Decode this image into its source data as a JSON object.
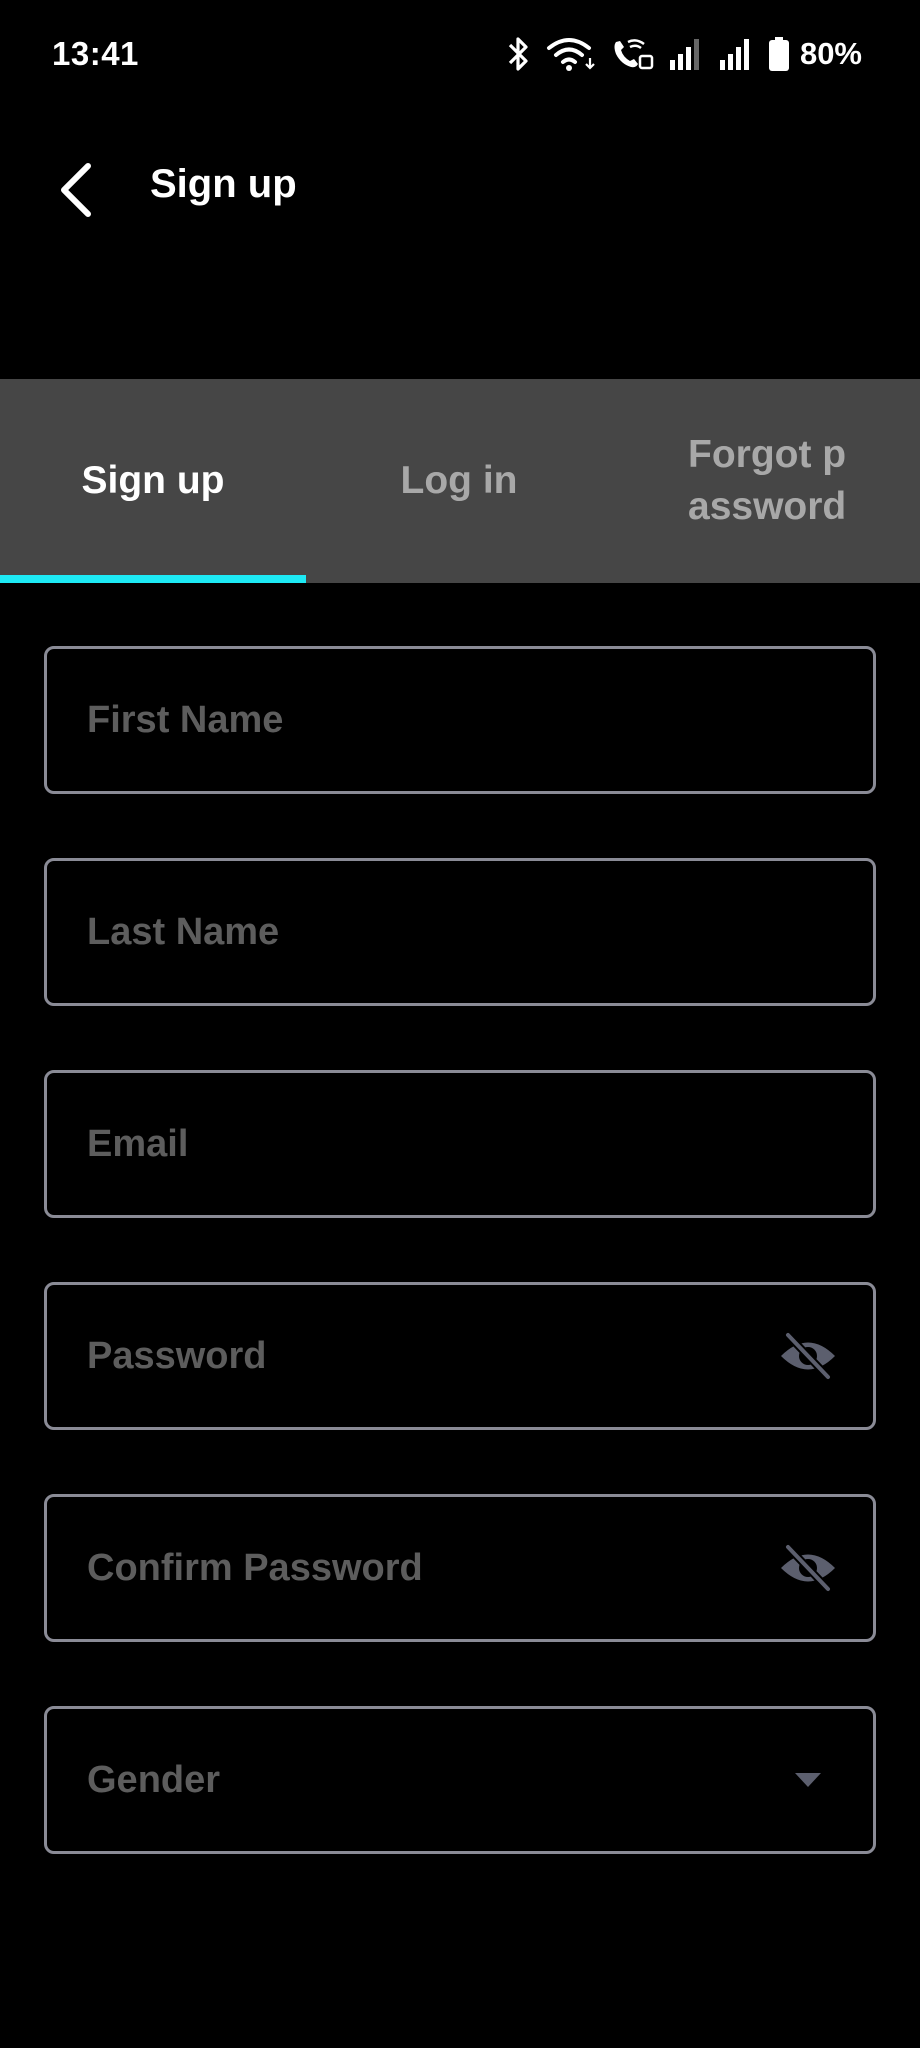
{
  "status_bar": {
    "time": "13:41",
    "battery": "80%",
    "icons": [
      "bluetooth-icon",
      "wifi-icon",
      "wifi-calling-icon",
      "signal-icon",
      "signal-icon",
      "battery-icon"
    ]
  },
  "app_bar": {
    "back_icon": "chevron-left-icon",
    "title": "Sign up"
  },
  "tabs": [
    {
      "label": "Sign up",
      "selected": true
    },
    {
      "label": "Log in",
      "selected": false
    },
    {
      "label": "Forgot password",
      "selected": false
    }
  ],
  "form": {
    "first_name": {
      "value": "",
      "placeholder": "First Name"
    },
    "last_name": {
      "value": "",
      "placeholder": "Last Name"
    },
    "email": {
      "value": "",
      "placeholder": "Email"
    },
    "password": {
      "value": "",
      "placeholder": "Password",
      "icon": "eye-off-icon"
    },
    "confirm_password": {
      "value": "",
      "placeholder": "Confirm Password",
      "icon": "eye-off-icon"
    },
    "gender": {
      "value": "",
      "placeholder": "Gender",
      "icon": "caret-down-icon"
    }
  },
  "colors": {
    "background": "#000000",
    "tab_bar": "#464646",
    "accent": "#1de9f4",
    "border": "#8a8b96",
    "placeholder": "#5d5d5d",
    "inactive_tab": "#a8a8a8",
    "icon": "#5c5f6e"
  }
}
